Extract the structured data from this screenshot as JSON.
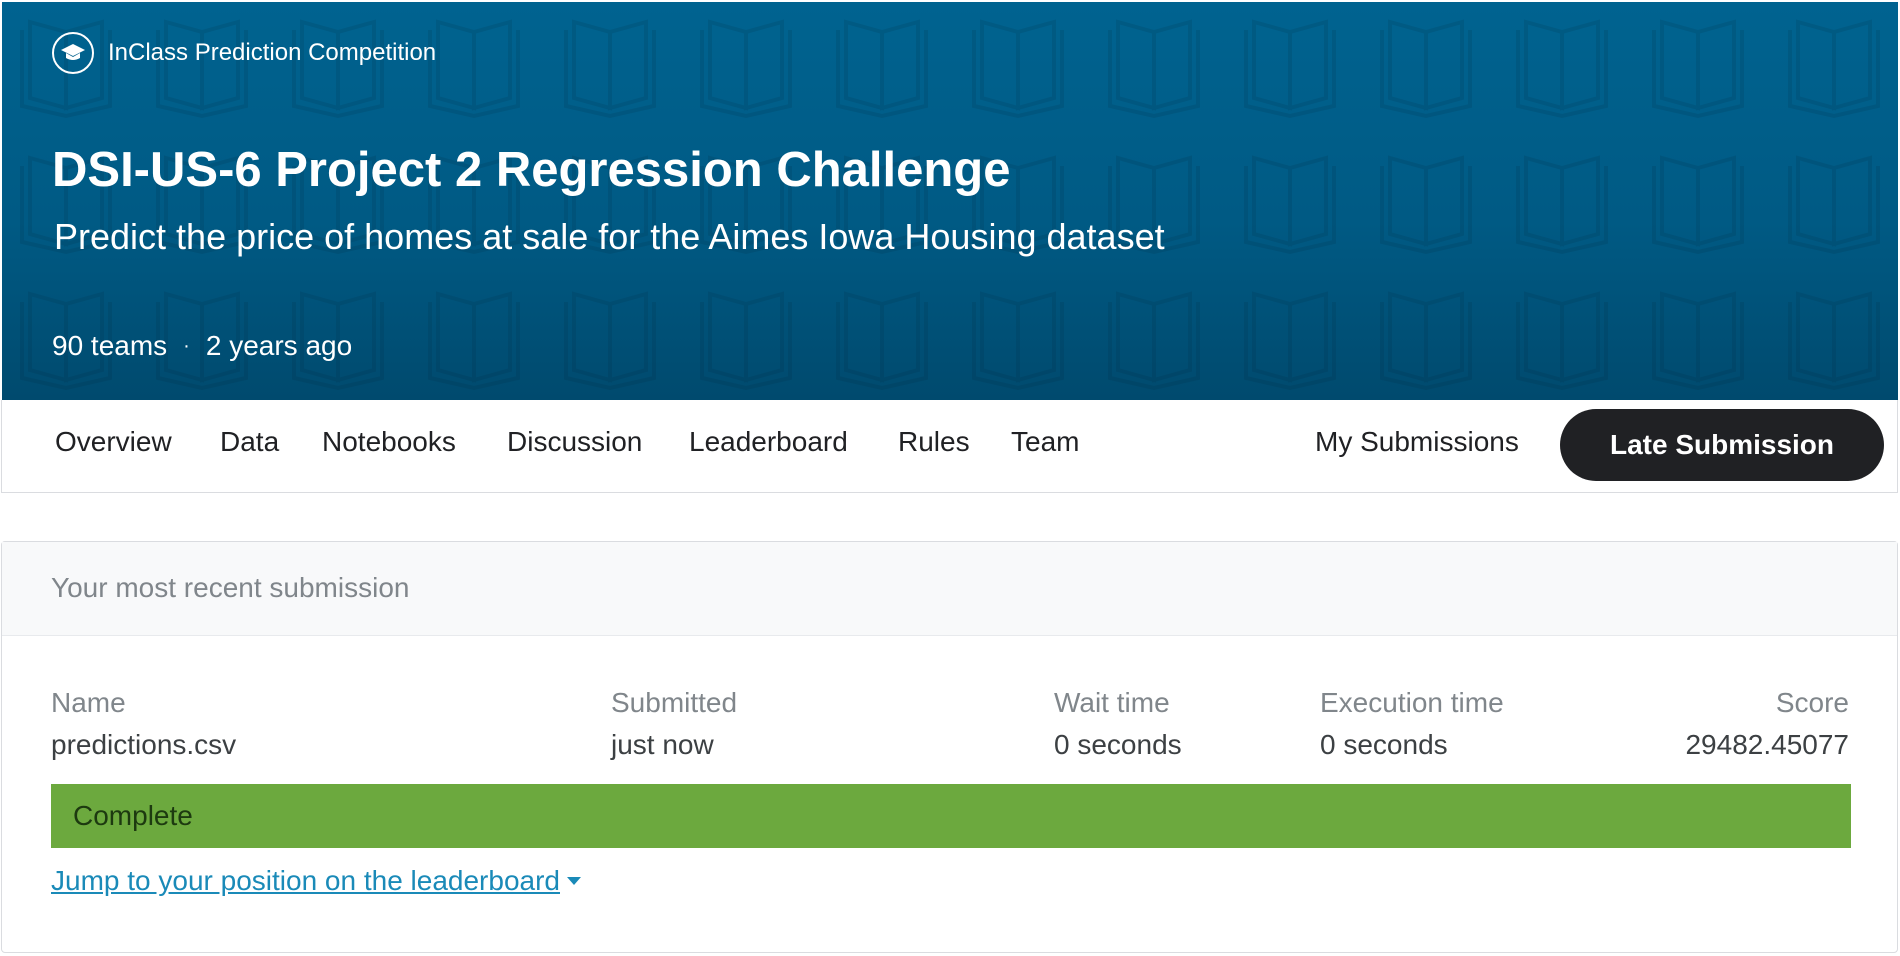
{
  "header": {
    "competition_type": "InClass Prediction Competition",
    "title": "DSI-US-6 Project 2 Regression Challenge",
    "subtitle": "Predict the price of homes at sale for the Aimes Iowa Housing dataset",
    "teams": "90 teams",
    "separator": "·",
    "age": "2 years ago",
    "bg_color": "#006390"
  },
  "nav": {
    "tabs": [
      "Overview",
      "Data",
      "Notebooks",
      "Discussion",
      "Leaderboard",
      "Rules",
      "Team"
    ],
    "my_submissions": "My Submissions",
    "late_submission": "Late Submission"
  },
  "submission": {
    "heading": "Your most recent submission",
    "columns": {
      "name_label": "Name",
      "name_value": "predictions.csv",
      "submitted_label": "Submitted",
      "submitted_value": "just now",
      "wait_label": "Wait time",
      "wait_value": "0 seconds",
      "exec_label": "Execution time",
      "exec_value": "0 seconds",
      "score_label": "Score",
      "score_value": "29482.45077"
    },
    "status": "Complete",
    "status_color": "#6ca93e",
    "jump_link": "Jump to your position on the leaderboard"
  },
  "icons": {
    "competition_type": "graduation-cap-icon",
    "dropdown": "caret-down-icon",
    "pattern": "open-book-icon"
  }
}
